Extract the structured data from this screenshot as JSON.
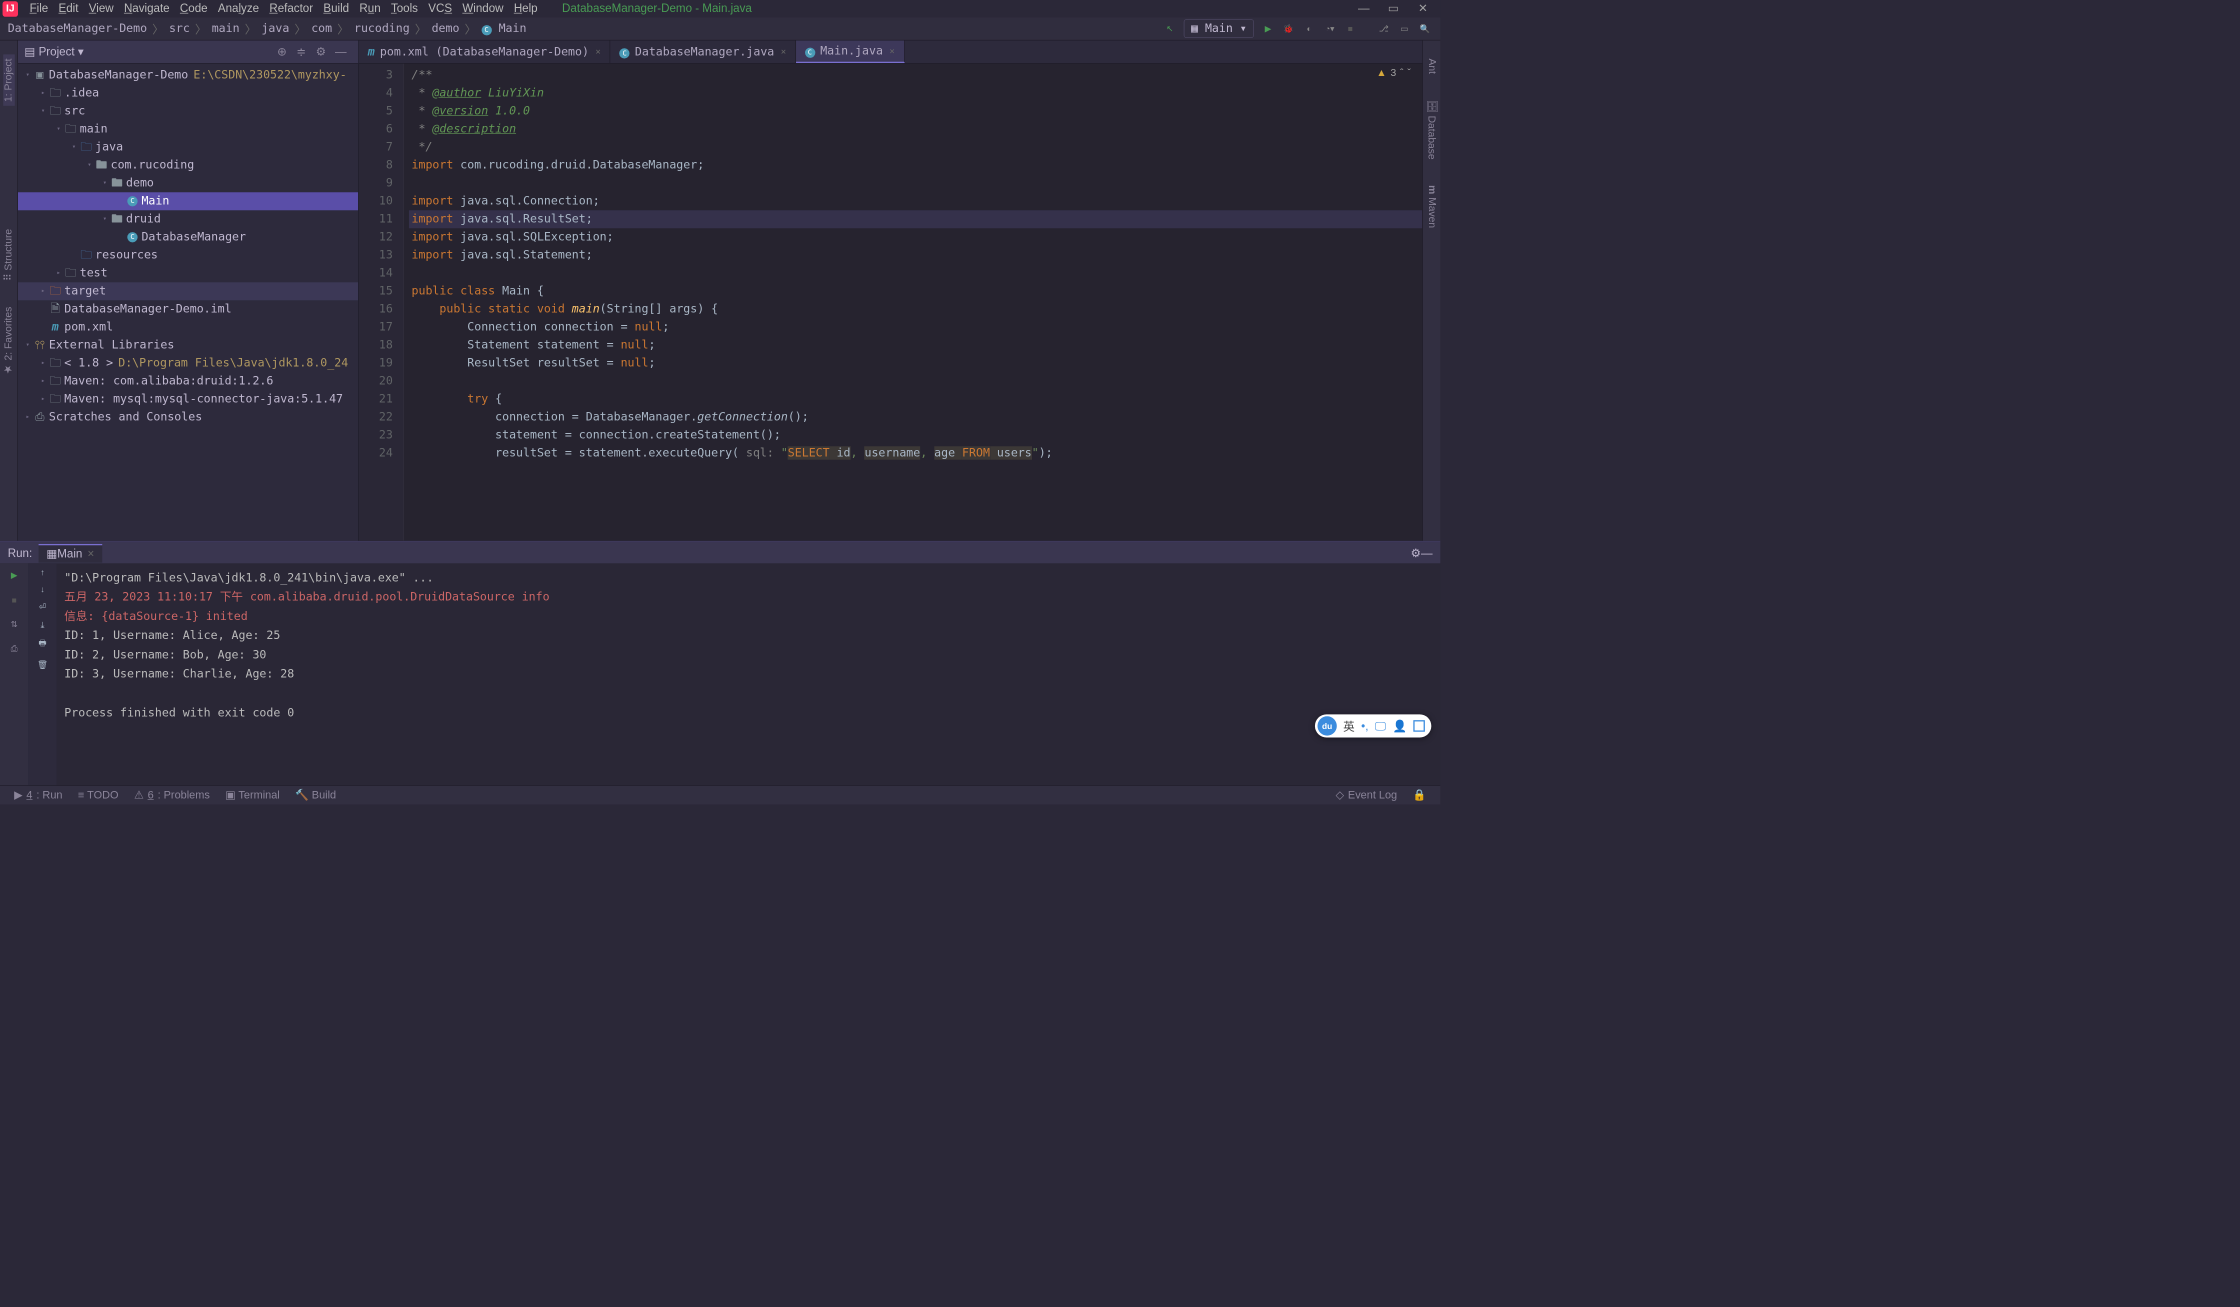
{
  "window_title": "DatabaseManager-Demo - Main.java",
  "menu": [
    "File",
    "Edit",
    "View",
    "Navigate",
    "Code",
    "Analyze",
    "Refactor",
    "Build",
    "Run",
    "Tools",
    "VCS",
    "Window",
    "Help"
  ],
  "menu_underline_idx": [
    0,
    0,
    0,
    0,
    0,
    3,
    0,
    0,
    1,
    0,
    2,
    0,
    0
  ],
  "breadcrumbs": [
    "DatabaseManager-Demo",
    "src",
    "main",
    "java",
    "com",
    "rucoding",
    "demo",
    "Main"
  ],
  "run_config_selected": "Main",
  "project_panel_title": "Project",
  "tree": {
    "root": {
      "label": "DatabaseManager-Demo",
      "extra": "E:\\CSDN\\230522\\myzhxy-",
      "extra_class": "gold"
    },
    "nodes": [
      {
        "indent": 1,
        "arrow": "▸",
        "icon": "folder",
        "label": ".idea"
      },
      {
        "indent": 1,
        "arrow": "▾",
        "icon": "folder",
        "label": "src"
      },
      {
        "indent": 2,
        "arrow": "▾",
        "icon": "folder",
        "label": "main"
      },
      {
        "indent": 3,
        "arrow": "▾",
        "icon": "folder-b",
        "label": "java"
      },
      {
        "indent": 4,
        "arrow": "▾",
        "icon": "pkg",
        "label": "com.rucoding"
      },
      {
        "indent": 5,
        "arrow": "▾",
        "icon": "pkg",
        "label": "demo"
      },
      {
        "indent": 6,
        "arrow": "",
        "icon": "class",
        "label": "Main",
        "selected": true
      },
      {
        "indent": 5,
        "arrow": "▾",
        "icon": "pkg",
        "label": "druid"
      },
      {
        "indent": 6,
        "arrow": "",
        "icon": "class",
        "label": "DatabaseManager"
      },
      {
        "indent": 3,
        "arrow": "",
        "icon": "folder-r",
        "label": "resources"
      },
      {
        "indent": 2,
        "arrow": "▸",
        "icon": "folder",
        "label": "test"
      },
      {
        "indent": 1,
        "arrow": "▸",
        "icon": "folder-o",
        "label": "target",
        "hl": true
      },
      {
        "indent": 1,
        "arrow": "",
        "icon": "file",
        "label": "DatabaseManager-Demo.iml"
      },
      {
        "indent": 1,
        "arrow": "",
        "icon": "m",
        "label": "pom.xml"
      }
    ],
    "ext_lib_label": "External Libraries",
    "ext_nodes": [
      {
        "label": "< 1.8 >",
        "extra": "D:\\Program Files\\Java\\jdk1.8.0_24"
      },
      {
        "label": "Maven: com.alibaba:druid:1.2.6"
      },
      {
        "label": "Maven: mysql:mysql-connector-java:5.1.47"
      }
    ],
    "scratches": "Scratches and Consoles"
  },
  "editor_tabs": [
    {
      "icon": "m",
      "label": "pom.xml (DatabaseManager-Demo)",
      "active": false
    },
    {
      "icon": "c",
      "label": "DatabaseManager.java",
      "active": false
    },
    {
      "icon": "c",
      "label": "Main.java",
      "active": true
    }
  ],
  "warn_count": "3",
  "code": {
    "start": 3,
    "run_markers": [
      15,
      16
    ],
    "highlighted": 11,
    "lines": [
      {
        "n": 3,
        "segs": [
          {
            "t": "/**",
            "c": "cmt"
          }
        ]
      },
      {
        "n": 4,
        "segs": [
          {
            "t": " * ",
            "c": "cmt"
          },
          {
            "t": "@author",
            "c": "cmt-tag"
          },
          {
            "t": " LiuYiXin",
            "c": "cmt-tag-nu"
          }
        ]
      },
      {
        "n": 5,
        "segs": [
          {
            "t": " * ",
            "c": "cmt"
          },
          {
            "t": "@version",
            "c": "cmt-tag"
          },
          {
            "t": " 1.0.0",
            "c": "cmt-tag-nu"
          }
        ]
      },
      {
        "n": 6,
        "segs": [
          {
            "t": " * ",
            "c": "cmt"
          },
          {
            "t": "@description",
            "c": "cmt-tag"
          }
        ]
      },
      {
        "n": 7,
        "segs": [
          {
            "t": " */",
            "c": "cmt"
          }
        ]
      },
      {
        "n": 8,
        "segs": [
          {
            "t": "import ",
            "c": "kw"
          },
          {
            "t": "com.rucoding.druid.DatabaseManager;"
          }
        ]
      },
      {
        "n": 9,
        "segs": []
      },
      {
        "n": 10,
        "segs": [
          {
            "t": "import ",
            "c": "kw"
          },
          {
            "t": "java.sql.Connection;"
          }
        ]
      },
      {
        "n": 11,
        "segs": [
          {
            "t": "import ",
            "c": "kw"
          },
          {
            "t": "java.sql.ResultSet;"
          }
        ]
      },
      {
        "n": 12,
        "segs": [
          {
            "t": "import ",
            "c": "kw"
          },
          {
            "t": "java.sql.SQLException;"
          }
        ]
      },
      {
        "n": 13,
        "segs": [
          {
            "t": "import ",
            "c": "kw"
          },
          {
            "t": "java.sql.Statement;"
          }
        ]
      },
      {
        "n": 14,
        "segs": []
      },
      {
        "n": 15,
        "segs": [
          {
            "t": "public class ",
            "c": "kw"
          },
          {
            "t": "Main {"
          }
        ]
      },
      {
        "n": 16,
        "segs": [
          {
            "t": "    "
          },
          {
            "t": "public static void ",
            "c": "kw"
          },
          {
            "t": "main",
            "c": "func"
          },
          {
            "t": "(String[] args) {"
          }
        ]
      },
      {
        "n": 17,
        "segs": [
          {
            "t": "        Connection "
          },
          {
            "t": "connection"
          },
          {
            "t": " = "
          },
          {
            "t": "null",
            "c": "kw"
          },
          {
            "t": ";"
          }
        ]
      },
      {
        "n": 18,
        "segs": [
          {
            "t": "        Statement "
          },
          {
            "t": "statement"
          },
          {
            "t": " = "
          },
          {
            "t": "null",
            "c": "kw"
          },
          {
            "t": ";"
          }
        ]
      },
      {
        "n": 19,
        "segs": [
          {
            "t": "        ResultSet "
          },
          {
            "t": "resultSet"
          },
          {
            "t": " = "
          },
          {
            "t": "null",
            "c": "kw"
          },
          {
            "t": ";"
          }
        ]
      },
      {
        "n": 20,
        "segs": []
      },
      {
        "n": 21,
        "segs": [
          {
            "t": "        "
          },
          {
            "t": "try ",
            "c": "kw"
          },
          {
            "t": "{"
          }
        ]
      },
      {
        "n": 22,
        "segs": [
          {
            "t": "            "
          },
          {
            "t": "connection"
          },
          {
            "t": " = DatabaseManager."
          },
          {
            "t": "getConnection",
            "c": "ital"
          },
          {
            "t": "();"
          }
        ]
      },
      {
        "n": 23,
        "segs": [
          {
            "t": "            statement = connection.createStatement();"
          }
        ]
      },
      {
        "n": 24,
        "segs": [
          {
            "t": "            "
          },
          {
            "t": "resultSet"
          },
          {
            "t": " = statement.executeQuery( "
          },
          {
            "t": "sql: ",
            "c": "param"
          },
          {
            "t": "\"",
            "c": "str"
          },
          {
            "t": "SELECT",
            "c": "sqlkw"
          },
          {
            "t": " id",
            "c": "sqltext"
          },
          {
            "t": ", ",
            "c": "str"
          },
          {
            "t": "username",
            "c": "sqltext"
          },
          {
            "t": ", ",
            "c": "str"
          },
          {
            "t": "age ",
            "c": "sqltext"
          },
          {
            "t": "FROM",
            "c": "sqlkw"
          },
          {
            "t": " users",
            "c": "sqltext"
          },
          {
            "t": "\"",
            "c": "str"
          },
          {
            "t": ");"
          }
        ]
      }
    ]
  },
  "run_panel": {
    "title": "Run:",
    "tab": "Main",
    "lines": [
      {
        "t": "\"D:\\Program Files\\Java\\jdk1.8.0_241\\bin\\java.exe\" ...",
        "c": ""
      },
      {
        "t": "五月 23, 2023 11:10:17 下午 com.alibaba.druid.pool.DruidDataSource info",
        "c": "red"
      },
      {
        "t": "信息: {dataSource-1} inited",
        "c": "red"
      },
      {
        "t": "ID: 1, Username: Alice, Age: 25",
        "c": ""
      },
      {
        "t": "ID: 2, Username: Bob, Age: 30",
        "c": ""
      },
      {
        "t": "ID: 3, Username: Charlie, Age: 28",
        "c": ""
      },
      {
        "t": "",
        "c": ""
      },
      {
        "t": "Process finished with exit code 0",
        "c": ""
      }
    ]
  },
  "statusbar": {
    "items": [
      {
        "icon": "▶",
        "label": "4: Run",
        "u": "4"
      },
      {
        "icon": "≡",
        "label": "TODO"
      },
      {
        "icon": "⚠",
        "label": "6: Problems",
        "u": "6"
      },
      {
        "icon": "▣",
        "label": "Terminal"
      },
      {
        "icon": "🔨",
        "label": "Build"
      }
    ],
    "event_log": "Event Log"
  },
  "left_tools": [
    "1: Project",
    "Structure",
    "2: Favorites"
  ],
  "left_prefix": [
    "▤",
    "⠿",
    "★"
  ],
  "right_tools": [
    "Ant",
    "Database",
    "Maven"
  ],
  "floater_lang": "英"
}
